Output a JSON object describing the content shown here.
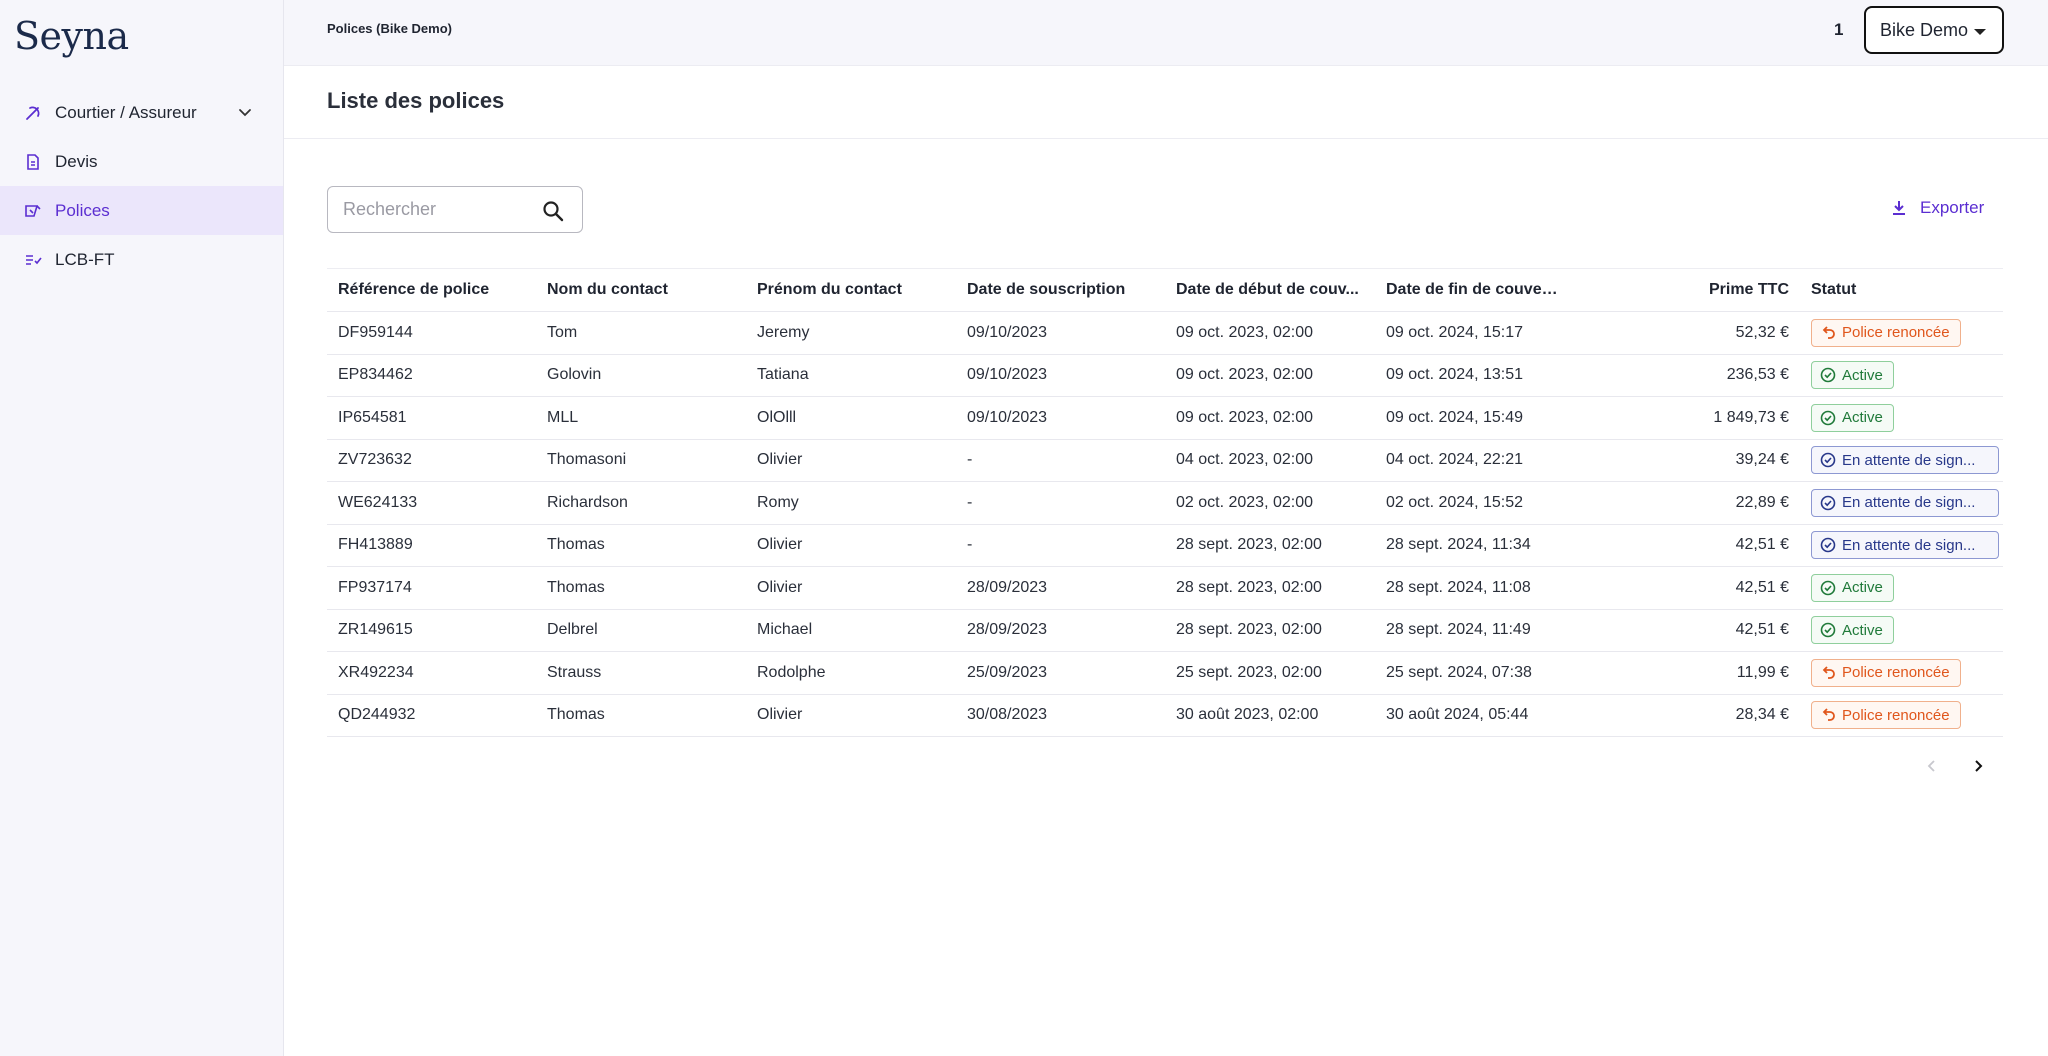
{
  "app": {
    "logo": "Seyna"
  },
  "sidebar": {
    "items": [
      {
        "label": "Courtier / Assureur",
        "icon": "broker-icon",
        "expandable": true
      },
      {
        "label": "Devis",
        "icon": "document-icon"
      },
      {
        "label": "Polices",
        "icon": "policy-icon",
        "active": true
      },
      {
        "label": "LCB-FT",
        "icon": "checklist-icon"
      }
    ]
  },
  "header": {
    "title": "Polices (Bike Demo)",
    "count": "1",
    "environment": "Bike Demo"
  },
  "page": {
    "title": "Liste des polices"
  },
  "search": {
    "placeholder": "Rechercher",
    "value": ""
  },
  "toolbar": {
    "export_label": "Exporter"
  },
  "table": {
    "columns": [
      "Référence de police",
      "Nom du contact",
      "Prénom du contact",
      "Date de souscription",
      "Date de début de couv...",
      "Date de fin de couvert...",
      "Prime TTC",
      "Statut"
    ],
    "rows": [
      {
        "ref": "DF959144",
        "nom": "Tom",
        "prenom": "Jeremy",
        "souscription": "09/10/2023",
        "debut": "09 oct. 2023, 02:00",
        "fin": "09 oct. 2024, 15:17",
        "prime": "52,32 €",
        "statut": "Police renoncée",
        "statut_type": "renoncee"
      },
      {
        "ref": "EP834462",
        "nom": "Golovin",
        "prenom": "Tatiana",
        "souscription": "09/10/2023",
        "debut": "09 oct. 2023, 02:00",
        "fin": "09 oct. 2024, 13:51",
        "prime": "236,53 €",
        "statut": "Active",
        "statut_type": "active"
      },
      {
        "ref": "IP654581",
        "nom": "MLL",
        "prenom": "OlOlll",
        "souscription": "09/10/2023",
        "debut": "09 oct. 2023, 02:00",
        "fin": "09 oct. 2024, 15:49",
        "prime": "1 849,73 €",
        "statut": "Active",
        "statut_type": "active"
      },
      {
        "ref": "ZV723632",
        "nom": "Thomasoni",
        "prenom": "Olivier",
        "souscription": "-",
        "debut": "04 oct. 2023, 02:00",
        "fin": "04 oct. 2024, 22:21",
        "prime": "39,24 €",
        "statut": "En attente de sign...",
        "statut_type": "attente"
      },
      {
        "ref": "WE624133",
        "nom": "Richardson",
        "prenom": "Romy",
        "souscription": "-",
        "debut": "02 oct. 2023, 02:00",
        "fin": "02 oct. 2024, 15:52",
        "prime": "22,89 €",
        "statut": "En attente de sign...",
        "statut_type": "attente"
      },
      {
        "ref": "FH413889",
        "nom": "Thomas",
        "prenom": "Olivier",
        "souscription": "-",
        "debut": "28 sept. 2023, 02:00",
        "fin": "28 sept. 2024, 11:34",
        "prime": "42,51 €",
        "statut": "En attente de sign...",
        "statut_type": "attente"
      },
      {
        "ref": "FP937174",
        "nom": "Thomas",
        "prenom": "Olivier",
        "souscription": "28/09/2023",
        "debut": "28 sept. 2023, 02:00",
        "fin": "28 sept. 2024, 11:08",
        "prime": "42,51 €",
        "statut": "Active",
        "statut_type": "active"
      },
      {
        "ref": "ZR149615",
        "nom": "Delbrel",
        "prenom": "Michael",
        "souscription": "28/09/2023",
        "debut": "28 sept. 2023, 02:00",
        "fin": "28 sept. 2024, 11:49",
        "prime": "42,51 €",
        "statut": "Active",
        "statut_type": "active"
      },
      {
        "ref": "XR492234",
        "nom": "Strauss",
        "prenom": "Rodolphe",
        "souscription": "25/09/2023",
        "debut": "25 sept. 2023, 02:00",
        "fin": "25 sept. 2024, 07:38",
        "prime": "11,99 €",
        "statut": "Police renoncée",
        "statut_type": "renoncee"
      },
      {
        "ref": "QD244932",
        "nom": "Thomas",
        "prenom": "Olivier",
        "souscription": "30/08/2023",
        "debut": "30 août 2023, 02:00",
        "fin": "30 août 2024, 05:44",
        "prime": "28,34 €",
        "statut": "Police renoncée",
        "statut_type": "renoncee"
      }
    ]
  },
  "pagination": {
    "prev_icon": "chevron-left-icon",
    "next_icon": "chevron-right-icon"
  },
  "colors": {
    "accent": "#5b2ed1",
    "sidebar_bg": "#f6f6fb",
    "renoncee": "#e0561c",
    "active": "#207a3a",
    "attente": "#28388a"
  }
}
